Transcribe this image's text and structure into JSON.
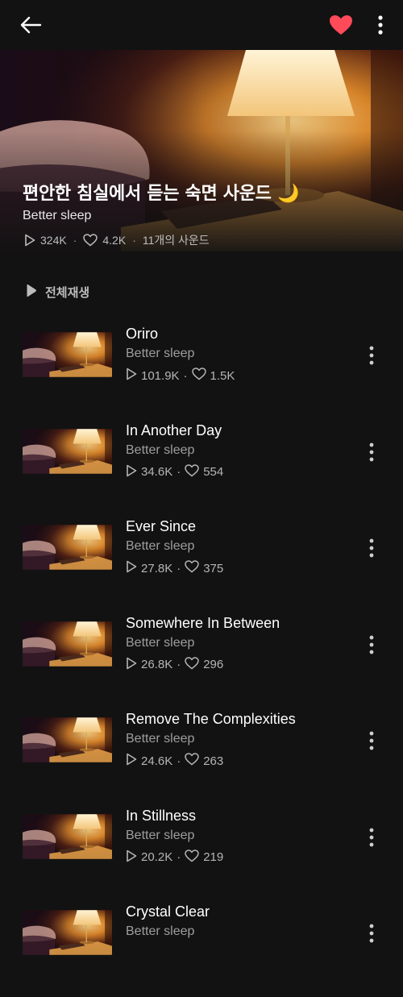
{
  "colors": {
    "background": "#121212",
    "heart": "#ff4a5a",
    "accent_light": "#f6c56c"
  },
  "header": {
    "back_icon": "arrow-left-icon",
    "like_icon": "heart-filled-icon",
    "more_icon": "more-vertical-icon"
  },
  "playlist": {
    "title": "편안한 침실에서 듣는 숙면 사운드 🌙",
    "artist": "Better sleep",
    "plays": "324K",
    "likes": "4.2K",
    "count": "11개의 사운드",
    "separator": "·"
  },
  "play_all_label": "전체재생",
  "tracks": [
    {
      "title": "Oriro",
      "artist": "Better sleep",
      "plays": "101.9K",
      "likes": "1.5K"
    },
    {
      "title": "In Another Day",
      "artist": "Better sleep",
      "plays": "34.6K",
      "likes": "554"
    },
    {
      "title": "Ever Since",
      "artist": "Better sleep",
      "plays": "27.8K",
      "likes": "375"
    },
    {
      "title": "Somewhere In Between",
      "artist": "Better sleep",
      "plays": "26.8K",
      "likes": "296"
    },
    {
      "title": "Remove The Complexities",
      "artist": "Better sleep",
      "plays": "24.6K",
      "likes": "263"
    },
    {
      "title": "In Stillness",
      "artist": "Better sleep",
      "plays": "20.2K",
      "likes": "219"
    },
    {
      "title": "Crystal Clear",
      "artist": "Better sleep",
      "plays": "",
      "likes": ""
    }
  ]
}
